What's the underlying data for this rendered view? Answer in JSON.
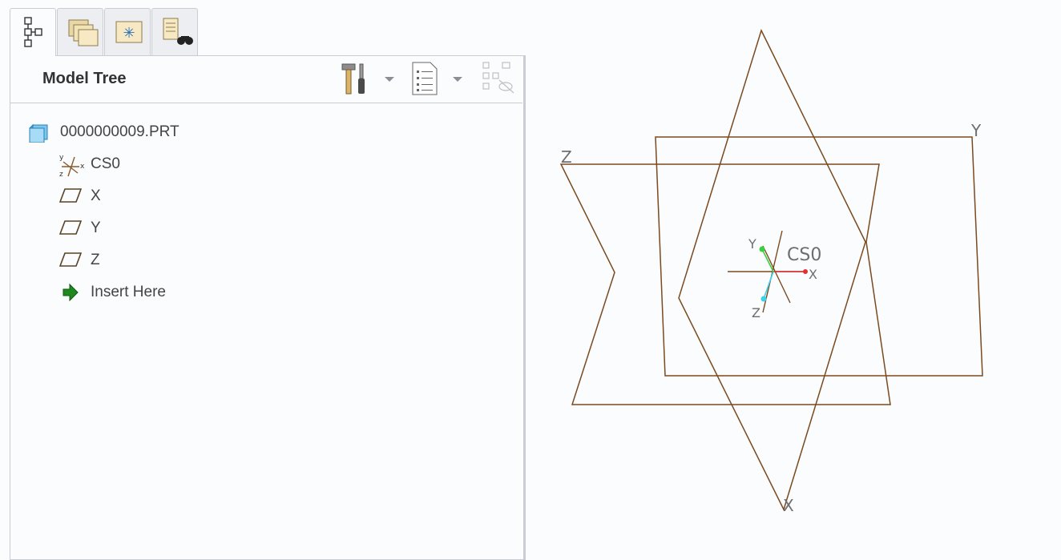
{
  "tabs": [
    {
      "icon": "model-tree-icon",
      "active": true
    },
    {
      "icon": "folder-browser-icon",
      "active": false
    },
    {
      "icon": "favorites-icon",
      "active": false
    },
    {
      "icon": "search-tool-icon",
      "active": false
    }
  ],
  "panel": {
    "title": "Model Tree",
    "toolbar": [
      {
        "icon": "settings-tools-icon"
      },
      {
        "icon": "tree-columns-icon"
      },
      {
        "icon": "tree-filter-icon"
      }
    ]
  },
  "tree": {
    "items": [
      {
        "label": "0000000009.PRT",
        "icon": "part-icon"
      },
      {
        "label": "CS0",
        "icon": "coordinate-system-icon"
      },
      {
        "label": "X",
        "icon": "datum-plane-icon"
      },
      {
        "label": "Y",
        "icon": "datum-plane-icon"
      },
      {
        "label": "Z",
        "icon": "datum-plane-icon"
      },
      {
        "label": "Insert Here",
        "icon": "insert-arrow-icon"
      }
    ]
  },
  "viewport": {
    "plane_labels": [
      "Y",
      "Z",
      "X"
    ],
    "csys_label": "CS0",
    "axis_labels": [
      "Y",
      "X",
      "Z"
    ],
    "colors": {
      "datum": "#7a4a1e",
      "axis_x": "#e03030",
      "axis_y": "#3ccf3c",
      "axis_z": "#3ed0e8"
    }
  }
}
